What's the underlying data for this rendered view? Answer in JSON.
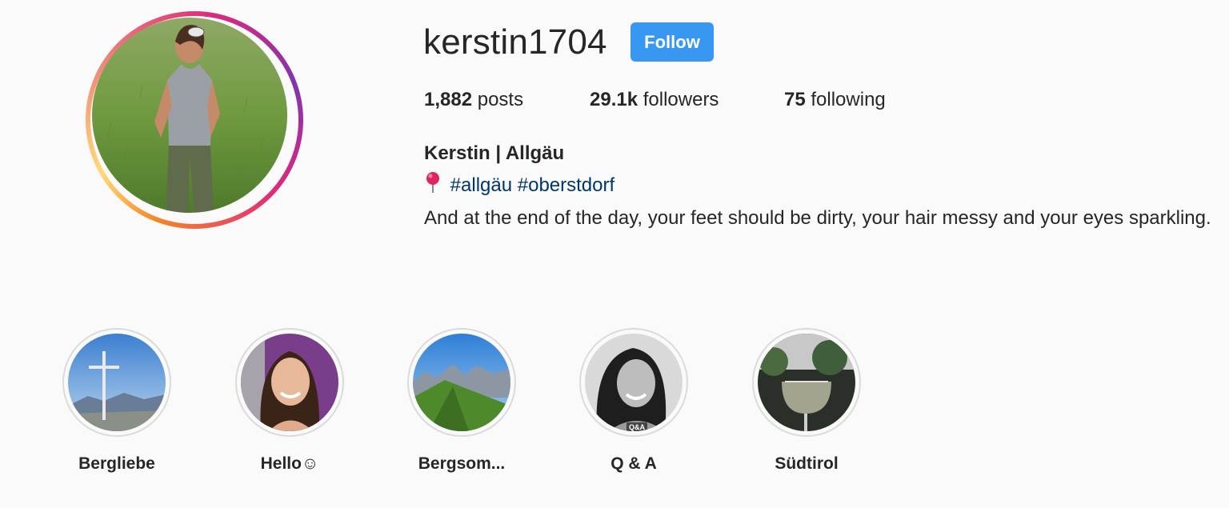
{
  "profile": {
    "username": "kerstin1704",
    "follow_label": "Follow",
    "stats": {
      "posts_count": "1,882",
      "posts_label": "posts",
      "followers_count": "29.1k",
      "followers_label": "followers",
      "following_count": "75",
      "following_label": "following"
    },
    "full_name": "Kerstin | Allgäu",
    "bio_tags": [
      "#allgäu",
      "#oberstdorf"
    ],
    "bio_text": "And at the end of the day, your feet should be dirty, your hair messy and your eyes sparkling.",
    "pin_icon": "round-pushpin-icon"
  },
  "highlights": [
    {
      "label": "Bergliebe"
    },
    {
      "label": "Hello☺"
    },
    {
      "label": "Bergsom..."
    },
    {
      "label": "Q & A",
      "badge": "Q&A"
    },
    {
      "label": "Südtirol"
    }
  ],
  "colors": {
    "follow_button": "#3897f0",
    "hashtag": "#00376b",
    "background": "#fafafa",
    "text": "#262626"
  }
}
